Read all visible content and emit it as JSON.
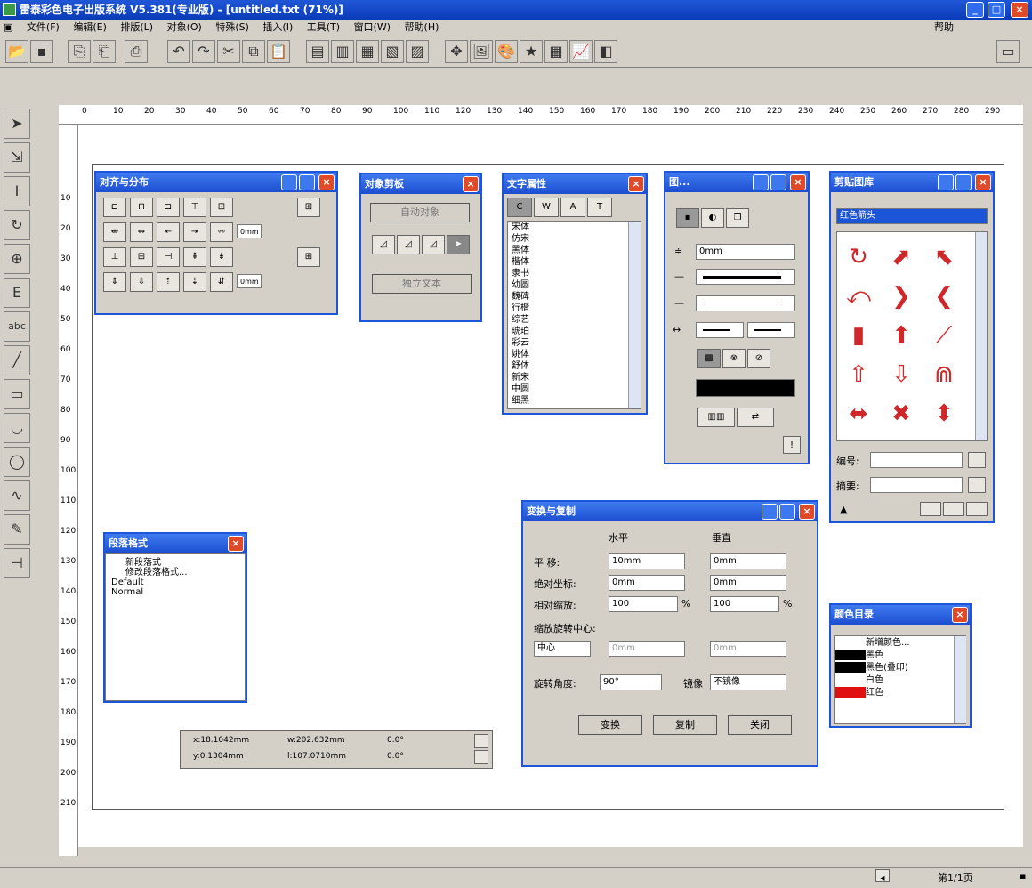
{
  "app": {
    "title": "雷泰彩色电子出版系统 V5.381(专业版) - [untitled.txt (71%)]"
  },
  "menu": {
    "items": [
      "文件(F)",
      "编辑(E)",
      "排版(L)",
      "对象(O)",
      "特殊(S)",
      "插入(I)",
      "工具(T)",
      "窗口(W)",
      "帮助(H)"
    ],
    "right_label": "帮助"
  },
  "ruler": {
    "h_ticks": [
      "0",
      "10",
      "20",
      "30",
      "40",
      "50",
      "60",
      "70",
      "80",
      "90",
      "100",
      "110",
      "120",
      "130",
      "140",
      "150",
      "160",
      "170",
      "180",
      "190",
      "200",
      "210",
      "220",
      "230",
      "240",
      "250",
      "260",
      "270",
      "280",
      "290"
    ],
    "v_ticks": [
      "10",
      "20",
      "30",
      "40",
      "50",
      "60",
      "70",
      "80",
      "90",
      "100",
      "110",
      "120",
      "130",
      "140",
      "150",
      "160",
      "170",
      "180",
      "190",
      "200",
      "210"
    ]
  },
  "align_palette": {
    "title": "对齐与分布",
    "spacing_values": [
      "0mm",
      "0mm"
    ]
  },
  "object_palette": {
    "title": "对象剪板",
    "btn_top": "自动对象",
    "btn_bottom": "独立文本"
  },
  "text_palette": {
    "title": "文字属性",
    "tabs": [
      "C",
      "W",
      "A",
      "T"
    ],
    "items": [
      "宋体",
      "仿宋",
      "黑体",
      "楷体",
      "隶书",
      "幼圆",
      "魏碑",
      "行楷",
      "综艺",
      "琥珀",
      "彩云",
      "姚体",
      "舒体",
      "新宋",
      "中圆",
      "细黑"
    ]
  },
  "line_palette": {
    "title": "图...",
    "width_value": "0mm"
  },
  "clip_palette": {
    "title": "剪贴图库",
    "category": "红色箭头",
    "label_code": "编号:",
    "label_summary": "摘要:",
    "code_value": "",
    "summary_value": ""
  },
  "transform_palette": {
    "title": "变换与复制",
    "col_h": "水平",
    "col_v": "垂直",
    "row_move": "平 移:",
    "row_abs": "绝对坐标:",
    "row_rel": "相对缩放:",
    "row_center": "缩放旋转中心:",
    "row_rotate": "旋转角度:",
    "move_h": "10mm",
    "move_v": "0mm",
    "abs_h": "0mm",
    "abs_v": "0mm",
    "scale_h": "100",
    "scale_v": "100",
    "pct": "%",
    "center_value": "中心",
    "center_h": "0mm",
    "center_v": "0mm",
    "rotate_value": "90°",
    "mirror_label": "镜像",
    "mirror_value": "不镜像",
    "btn_apply": "变换",
    "btn_copy": "复制",
    "btn_close": "关闭"
  },
  "para_palette": {
    "title": "段落格式",
    "items": [
      "新段落式",
      "修改段落格式...",
      "Default",
      "Normal"
    ]
  },
  "color_palette": {
    "title": "颜色目录",
    "items": [
      {
        "name": "新增颜色...",
        "color": "#ffffff"
      },
      {
        "name": "黑色",
        "color": "#000000"
      },
      {
        "name": "黑色(叠印)",
        "color": "#000000"
      },
      {
        "name": "白色",
        "color": "#ffffff"
      },
      {
        "name": "红色",
        "color": "#e01010"
      }
    ]
  },
  "coords_panel": {
    "x": "x:18.1042mm",
    "w": "w:202.632mm",
    "angle1": "0.0°",
    "y": "y:0.1304mm",
    "l": "l:107.0710mm",
    "angle2": "0.0°"
  },
  "status": {
    "page": "第1/1页"
  },
  "colors": {
    "title_blue": "#1c55d8",
    "close_red": "#e04a28",
    "arrow_red": "#d0282a"
  }
}
